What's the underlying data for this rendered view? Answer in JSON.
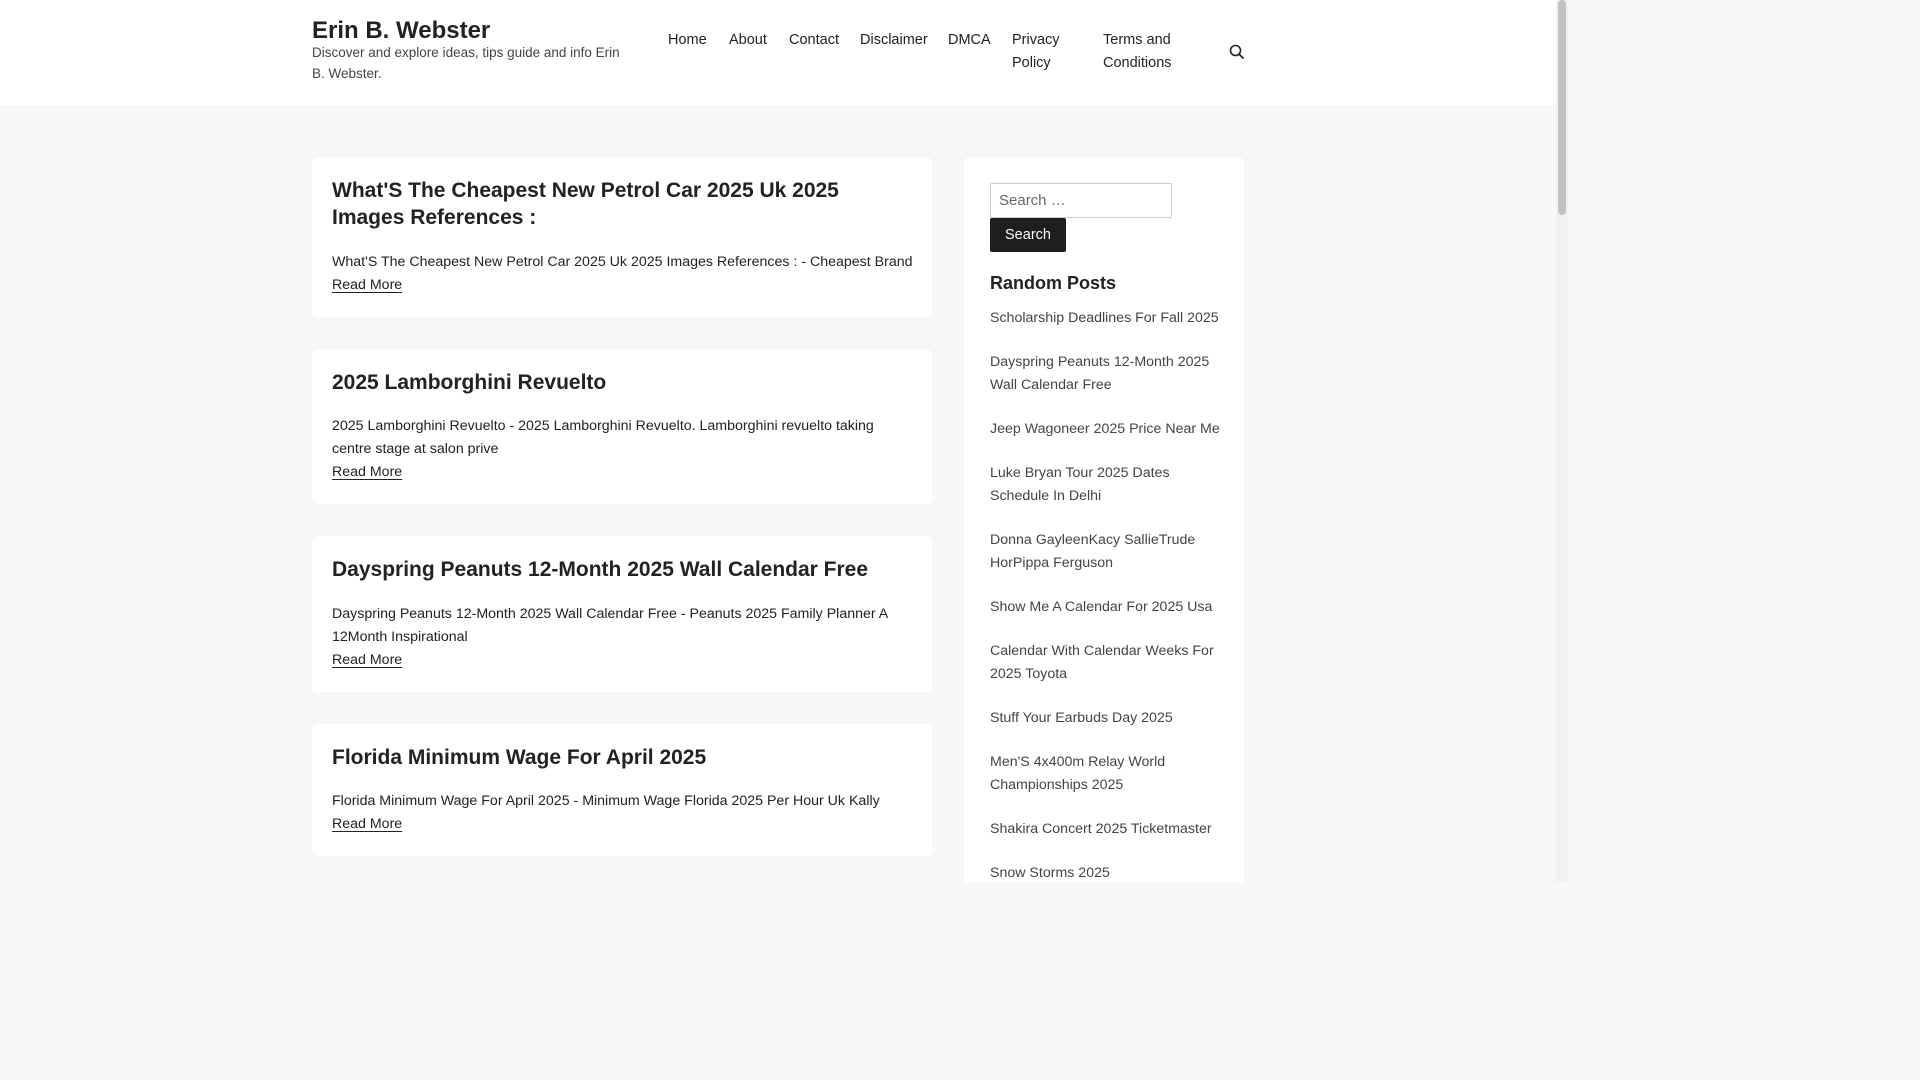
{
  "site": {
    "title": "Erin B. Webster",
    "description": "Discover and explore ideas, tips guide and info Erin B. Webster."
  },
  "nav": {
    "home": "Home",
    "about": "About",
    "contact": "Contact",
    "disclaimer": "Disclaimer",
    "dmca": "DMCA",
    "privacy_line1": "Privacy",
    "privacy_line2": "Policy",
    "terms_line1": "Terms and",
    "terms_line2": "Conditions",
    "search_icon": "search-icon"
  },
  "posts": [
    {
      "title": "What'S The Cheapest New Petrol Car 2025 Uk 2025 Images References :",
      "excerpt": "What'S The Cheapest New Petrol Car 2025 Uk 2025 Images References : - Cheapest Brand",
      "read_more": "Read More"
    },
    {
      "title": "2025 Lamborghini Revuelto",
      "excerpt": "2025 Lamborghini Revuelto - 2025 Lamborghini Revuelto. Lamborghini revuelto taking centre stage at salon prive",
      "read_more": "Read More"
    },
    {
      "title": "Dayspring Peanuts 12-Month 2025 Wall Calendar Free",
      "excerpt": "Dayspring Peanuts 12-Month 2025 Wall Calendar Free - Peanuts 2025 Family Planner A 12Month Inspirational",
      "read_more": "Read More"
    },
    {
      "title": "Florida Minimum Wage For April 2025",
      "excerpt": "Florida Minimum Wage For April 2025 - Minimum Wage Florida 2025 Per Hour Uk Kally",
      "read_more": "Read More"
    }
  ],
  "sidebar": {
    "search_placeholder": "Search …",
    "search_button": "Search",
    "random_title": "Random Posts",
    "random_posts": [
      "Scholarship Deadlines For Fall 2025",
      "Dayspring Peanuts 12-Month 2025 Wall Calendar Free",
      "Jeep Wagoneer 2025 Price Near Me",
      "Luke Bryan Tour 2025 Dates Schedule In Delhi",
      "Donna GayleenKacy SallieTrude HorPippa Ferguson",
      "Show Me A Calendar For 2025 Usa",
      "Calendar With Calendar Weeks For 2025 Toyota",
      "Stuff Your Earbuds Day 2025",
      "Men'S 4x400m Relay World Championships 2025",
      "Shakira Concert 2025 Ticketmaster",
      "Snow Storms 2025"
    ]
  },
  "colors": {
    "page_background": "#f6f7f8",
    "card_background": "#ffffff",
    "button_background": "#1e1e1e",
    "text": "#222222"
  }
}
